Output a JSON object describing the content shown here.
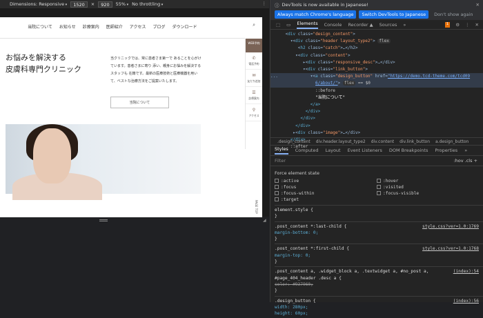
{
  "toolbar": {
    "dimensions": "Dimensions: Responsive",
    "width": "1520",
    "x": "×",
    "height": "920",
    "zoom": "55%",
    "throttle": "No throttling"
  },
  "site": {
    "nav": [
      "当院について",
      "お知らせ",
      "診療案内",
      "医師紹介",
      "アクセス",
      "ブログ",
      "ダウンロード"
    ],
    "side_top": "WEB予約",
    "side_items": [
      "電話予約",
      "友だち追加",
      "診療案内",
      "アクセス"
    ],
    "heading_line1": "お悩みを解決する",
    "heading_line2": "皮膚科専門クリニック",
    "desc": "当クリニックでは、常に患者さま第一で あることを心がけています。患者さまに寄り 添い、親身にお悩みを解決するスタッフも 在籍です。最新の医療技術と医療機器を用い て、ベストな治療方法をご提案いたします。",
    "button": "当院について",
    "pagetop": "PAGE TOP"
  },
  "devtools": {
    "notice": "DevTools is now available in Japanese!",
    "btn_match": "Always match Chrome's language",
    "btn_switch": "Switch DevTools to Japanese",
    "dont_show": "Don't show again",
    "tabs": [
      "Elements",
      "Console",
      "Recorder ▲",
      "Sources",
      "»"
    ],
    "badge": "1",
    "tree": {
      "l1": {
        "pre": "      <",
        "tag": "div",
        "a": "class",
        "v": "\"design_content\""
      },
      "l2": {
        "pre": "        ▾<",
        "tag": "div",
        "a": "class",
        "v": "\"header layout_type2\"",
        "pill": "flex"
      },
      "l3": {
        "pre": "           <",
        "tag": "h2",
        "a": "class",
        "v": "\"catch\"",
        "post": ">…</h2>"
      },
      "l4": {
        "pre": "          ▾<",
        "tag": "div",
        "a": "class",
        "v": "\"content\""
      },
      "l5": {
        "pre": "             ▸<",
        "tag": "div",
        "a": "class",
        "v": "\"responsive_desc\"",
        "post": ">…</div>"
      },
      "l6": {
        "pre": "             ▾<",
        "tag": "div",
        "a": "class",
        "v": "\"link_button\""
      },
      "l7": {
        "pre": "...             ▾<",
        "tag": "a",
        "a": "class",
        "v": "\"design_button\"",
        "href_a": "href",
        "href": "\"https://demo.tcd-theme.com/tcd09",
        "href2": "6/about/\"",
        "pill": "flex",
        "eq": "== $0"
      },
      "l8": "                  ::before",
      "l9": "                  \"当院について\"",
      "l10": "                </a>",
      "l11": "              </div>",
      "l12": "            </div>",
      "l13": "          </div>",
      "l14": {
        "pre": "         ▸<",
        "tag": "div",
        "a": "class",
        "v": "\"image\"",
        "post": ">…</div>"
      },
      "l15": "        </div>",
      "l16": "        ::after"
    },
    "crumbs": [
      ".design_content",
      "div.header.layout_type2",
      "div.content",
      "div.link_button",
      "a.design_button"
    ],
    "subtabs": [
      "Styles",
      "Computed",
      "Layout",
      "Event Listeners",
      "DOM Breakpoints",
      "Properties",
      "»"
    ],
    "filter": "Filter",
    "filter_r": ":hov .cls +",
    "force": "Force element state",
    "states": [
      ":active",
      ":hover",
      ":focus",
      ":visited",
      ":focus-within",
      ":focus-visible",
      ":target"
    ],
    "css": [
      {
        "sel": "element.style {",
        "lines": [
          "}"
        ],
        "src": ""
      },
      {
        "sel": ".post_content *:last-child {",
        "lines": [
          "  margin-bottom: 0;",
          "}"
        ],
        "src": "style.css?ver=1.0:1769"
      },
      {
        "sel": ".post_content *:first-child {",
        "lines": [
          "  margin-top: 0;",
          "}"
        ],
        "src": "style.css?ver=1.0:1768"
      },
      {
        "sel": ".post_content a, .widget_block a, .textwidget a, #no_post a, #page_404_header .desc a {",
        "lines": [
          "  color: #937960;",
          "}"
        ],
        "src": "(index):54"
      },
      {
        "sel": ".design_button {",
        "lines": [
          "  width: 280px;",
          "  height: 60px;"
        ],
        "src": "(index):56"
      }
    ]
  }
}
